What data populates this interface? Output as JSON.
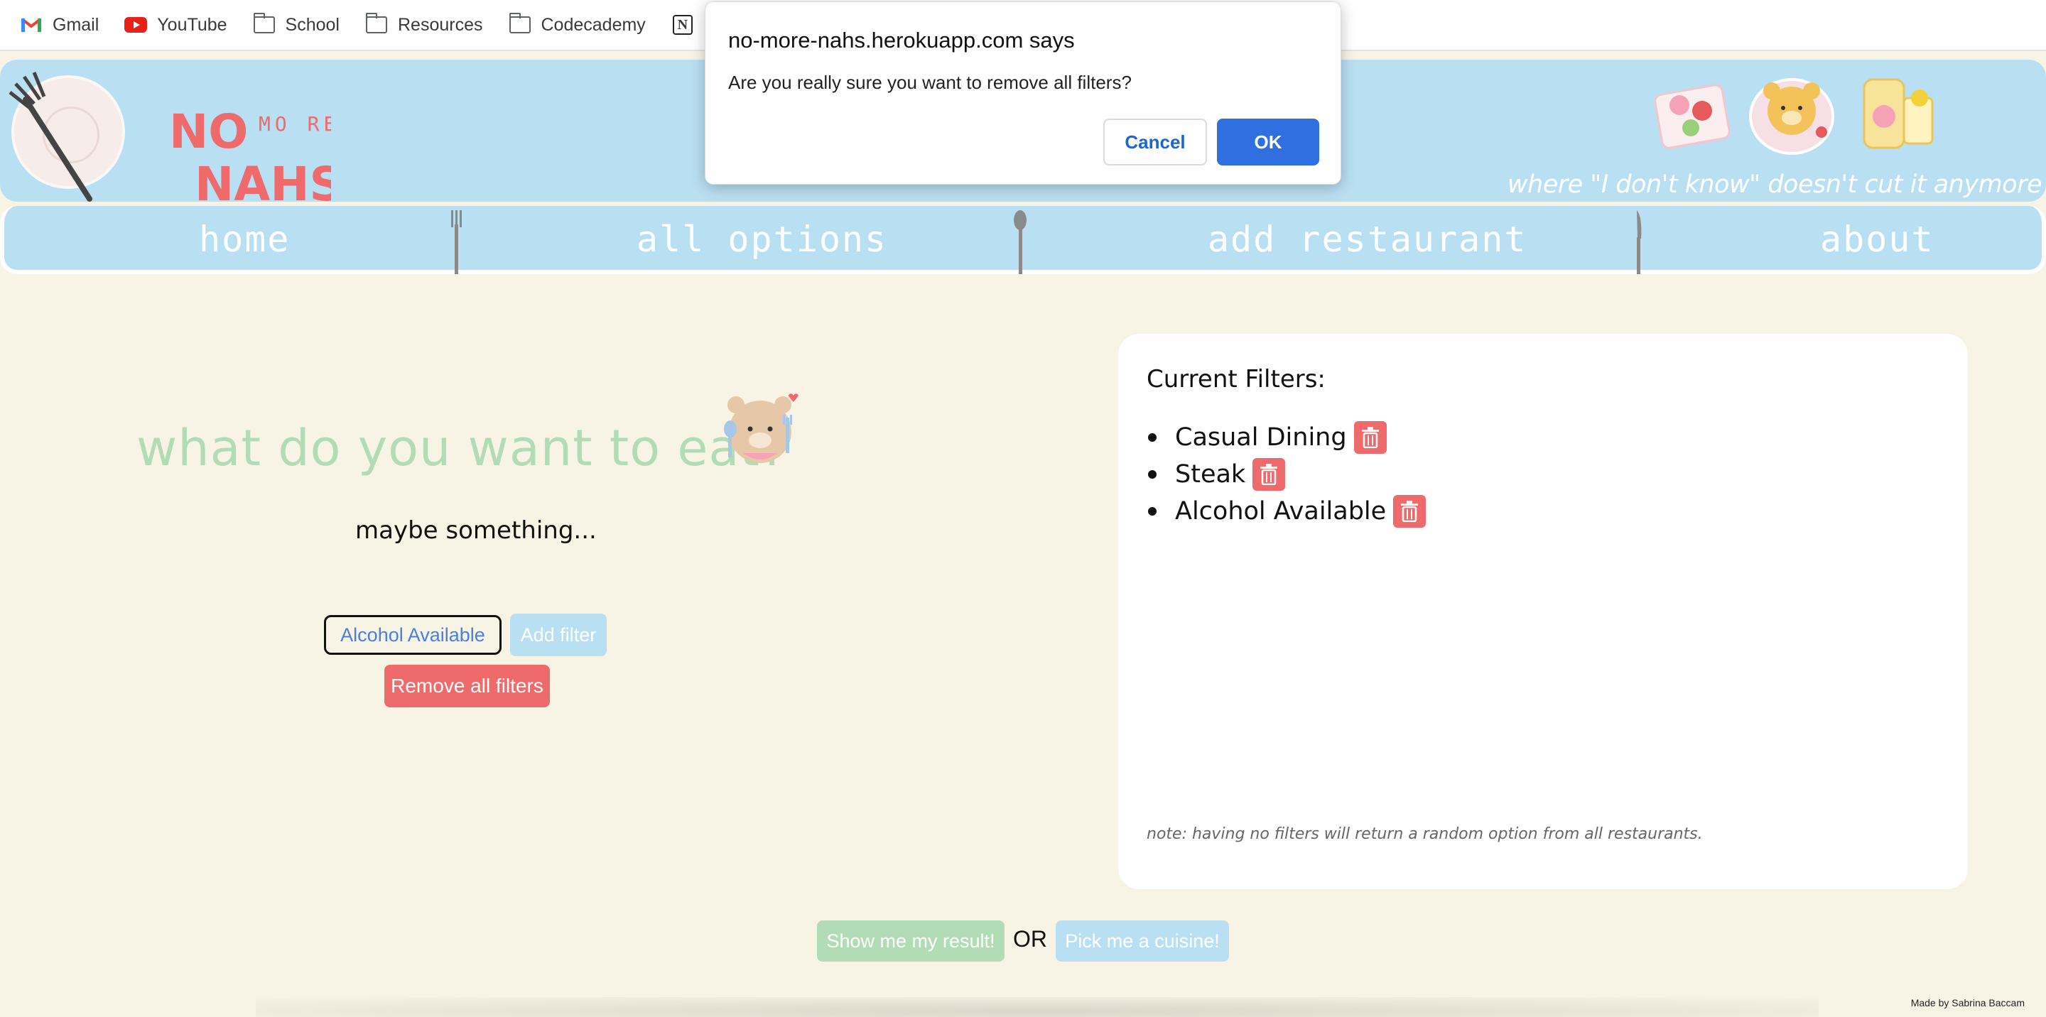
{
  "bookmarks": [
    {
      "label": "Gmail",
      "icon": "gmail-icon"
    },
    {
      "label": "YouTube",
      "icon": "youtube-icon"
    },
    {
      "label": "School",
      "icon": "folder-icon"
    },
    {
      "label": "Resources",
      "icon": "folder-icon"
    },
    {
      "label": "Codecademy",
      "icon": "folder-icon"
    },
    {
      "label": "N",
      "icon": "notion-icon"
    }
  ],
  "header": {
    "logo_line1": "NO",
    "logo_more": "MO RE",
    "logo_line2": "NAHS",
    "tagline": "where \"I don't know\" doesn't cut it anymore"
  },
  "nav": {
    "home": "home",
    "all_options": "all options",
    "add_restaurant": "add restaurant",
    "about": "about"
  },
  "main": {
    "question": "what do you want to eat?",
    "subtitle": "maybe something...",
    "filter_select_value": "Alcohol Available",
    "add_filter_label": "Add filter",
    "remove_all_label": "Remove all filters"
  },
  "filters_panel": {
    "title": "Current Filters:",
    "filters": [
      "Casual Dining",
      "Steak",
      "Alcohol Available"
    ],
    "note": "note: having no filters will return a random option from all restaurants."
  },
  "actions": {
    "show_result_label": "Show me my result!",
    "or_label": "OR",
    "pick_cuisine_label": "Pick me a cuisine!"
  },
  "footer": {
    "credit": "Made by Sabrina Baccam"
  },
  "dialog": {
    "title": "no-more-nahs.herokuapp.com says",
    "message": "Are you really sure you want to remove all filters?",
    "cancel_label": "Cancel",
    "ok_label": "OK"
  },
  "colors": {
    "banner": "#b9e0f2",
    "background": "#f8f4e5",
    "accent_green": "#b2dcb5",
    "danger": "#ef6a6a",
    "dialog_primary": "#2f6fe0"
  }
}
